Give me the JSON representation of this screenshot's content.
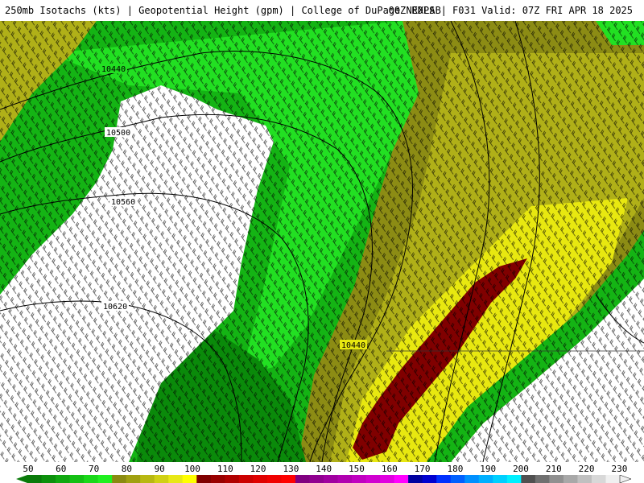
{
  "header": {
    "title_left": "250mb Isotachs (kts) | Geopotential Height (gpm) | College of DuPage NEXLAB",
    "title_right": "00Z RDPS | F031 Valid: 07Z FRI APR 18 2025"
  },
  "contours": {
    "labels": [
      "10440",
      "10500",
      "10560",
      "10620",
      "10440"
    ],
    "line_color": "#000000"
  },
  "colorbar": {
    "labels": [
      "50",
      "60",
      "70",
      "80",
      "90",
      "100",
      "110",
      "120",
      "130",
      "140",
      "150",
      "160",
      "170",
      "180",
      "190",
      "200",
      "210",
      "220",
      "230"
    ],
    "colors": [
      "#0a7a0a",
      "#0c900c",
      "#10a810",
      "#14c014",
      "#1ad81a",
      "#20f020",
      "#8a8a10",
      "#a0a010",
      "#b8b812",
      "#d0d014",
      "#e8e816",
      "#ffff00",
      "#800000",
      "#990000",
      "#b00000",
      "#cc0000",
      "#e00000",
      "#f00000",
      "#ff0000",
      "#800080",
      "#900090",
      "#a000a0",
      "#b000b0",
      "#c000c0",
      "#d000d0",
      "#e000e0",
      "#ff00ff",
      "#0000a0",
      "#0000d0",
      "#0030ff",
      "#0060ff",
      "#0090ff",
      "#00b0ff",
      "#00d0ff",
      "#00f0ff",
      "#505050",
      "#707070",
      "#909090",
      "#a8a8a8",
      "#c0c0c0",
      "#d8d8d8",
      "#f0f0f0"
    ]
  },
  "regions": {
    "low_speed_color": "#ffffff",
    "green_dark": "#0a8a0a",
    "green": "#14b414",
    "green_bright": "#22e022",
    "olive": "#8c8c14",
    "olive_light": "#b0b018",
    "yellow": "#e8e810",
    "jet_core": "#800000"
  }
}
